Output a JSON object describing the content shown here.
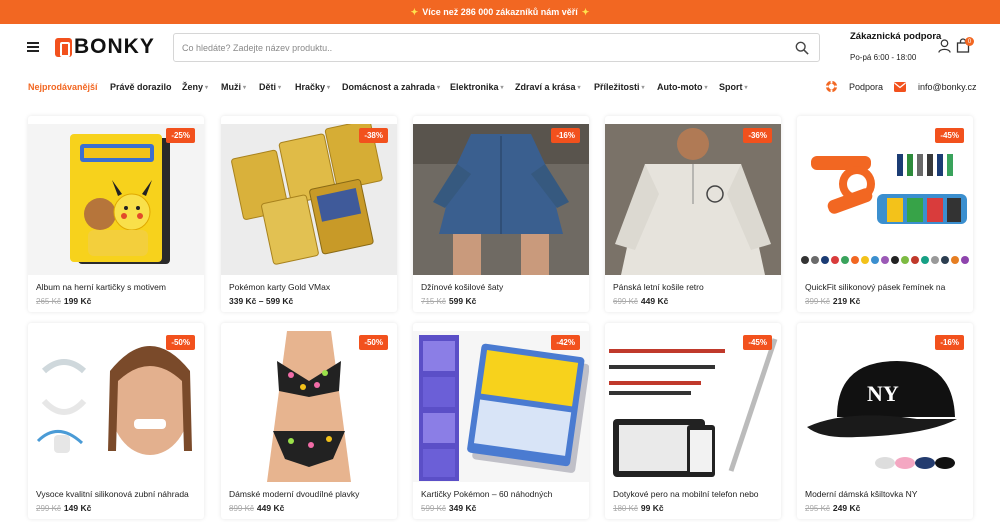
{
  "banner": {
    "text": "Více než 286 000 zákazníků nám věří"
  },
  "header": {
    "logo": "BONKY",
    "search_placeholder": "Co hledáte? Zadejte název produktu..",
    "support_title": "Zákaznická podpora",
    "support_hours": "Po-pá 6:00 - 18:00",
    "cart_count": "0"
  },
  "nav": {
    "items": [
      "Nejprodávanější",
      "Právě dorazilo",
      "Ženy",
      "Muži",
      "Děti",
      "Hračky",
      "Domácnost a zahrada",
      "Elektronika",
      "Zdraví a krása",
      "Příležitosti",
      "Auto-moto",
      "Sport"
    ],
    "support": "Podpora",
    "email": "info@bonky.cz"
  },
  "products": [
    {
      "title": "Album na herní kartičky s motivem",
      "old": "265 Kč",
      "price": "199 Kč",
      "discount": "-25%"
    },
    {
      "title": "Pokémon karty Gold VMax",
      "old": "",
      "price": "339 Kč – 599 Kč",
      "discount": "-38%"
    },
    {
      "title": "Džínové košilové šaty",
      "old": "715 Kč",
      "price": "599 Kč",
      "discount": "-16%"
    },
    {
      "title": "Pánská letní košile retro",
      "old": "699 Kč",
      "price": "449 Kč",
      "discount": "-36%"
    },
    {
      "title": "QuickFit silikonový pásek řemínek na",
      "old": "399 Kč",
      "price": "219 Kč",
      "discount": "-45%"
    },
    {
      "title": "Vysoce kvalitní silikonová zubní náhrada",
      "old": "299 Kč",
      "price": "149 Kč",
      "discount": "-50%"
    },
    {
      "title": "Dámské moderní dvoudílné plavky",
      "old": "899 Kč",
      "price": "449 Kč",
      "discount": "-50%"
    },
    {
      "title": "Kartičky Pokémon – 60 náhodných",
      "old": "599 Kč",
      "price": "349 Kč",
      "discount": "-42%"
    },
    {
      "title": "Dotykové pero na mobilní telefon nebo",
      "old": "180 Kč",
      "price": "99 Kč",
      "discount": "-45%"
    },
    {
      "title": "Moderní dámská kšiltovka NY",
      "old": "295 Kč",
      "price": "249 Kč",
      "discount": "-16%"
    }
  ]
}
